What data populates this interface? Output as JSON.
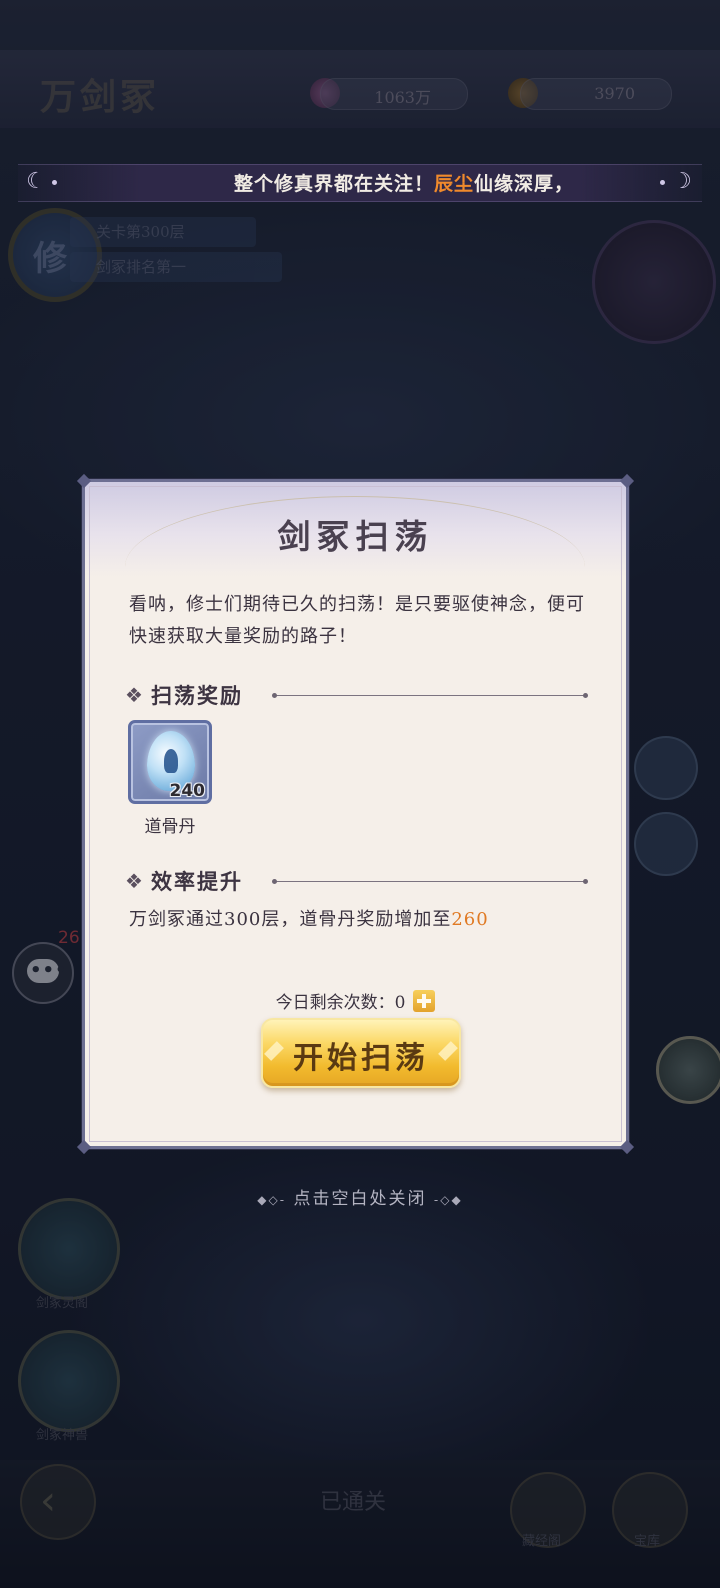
{
  "background": {
    "title": "万剑冢",
    "resource_1_value": "1063万",
    "resource_2_value": "3970",
    "info_line_1": "关卡第300层",
    "info_line_2": "剑冢排名第一",
    "avatar_badge": "修",
    "chat_badge_count": "26",
    "bottom_label_left_1": "剑冢灵阁",
    "bottom_label_left_2": "剑冢神兽",
    "bottom_center_label": "已通关",
    "bottom_label_right_1": "藏经阁",
    "bottom_label_right_2": "宝库"
  },
  "broadcast": {
    "prefix": "整个修真界都在关注！",
    "name": "辰尘",
    "suffix": "仙缘深厚，"
  },
  "dialog": {
    "title": "剑冢扫荡",
    "description": "看呐，修士们期待已久的扫荡！是只要驱使神念，便可快速获取大量奖励的路子！",
    "rewards_section_label": "扫荡奖励",
    "reward_item": {
      "name": "道骨丹",
      "quantity": "240",
      "icon": "dao-bone-pill-icon"
    },
    "efficiency_section_label": "效率提升",
    "bonus_text_prefix": "万剑冢通过300层，道骨丹奖励增加至",
    "bonus_value": "260",
    "remaining_label": "今日剩余次数：",
    "remaining_count": "0",
    "start_button_label": "开始扫荡"
  },
  "close_hint": "点击空白处关闭",
  "colors": {
    "highlight_orange": "#e07a24",
    "broadcast_name": "#f08a2c",
    "button_gold": "#f2bb2e",
    "dialog_bg": "#f5efe9"
  }
}
